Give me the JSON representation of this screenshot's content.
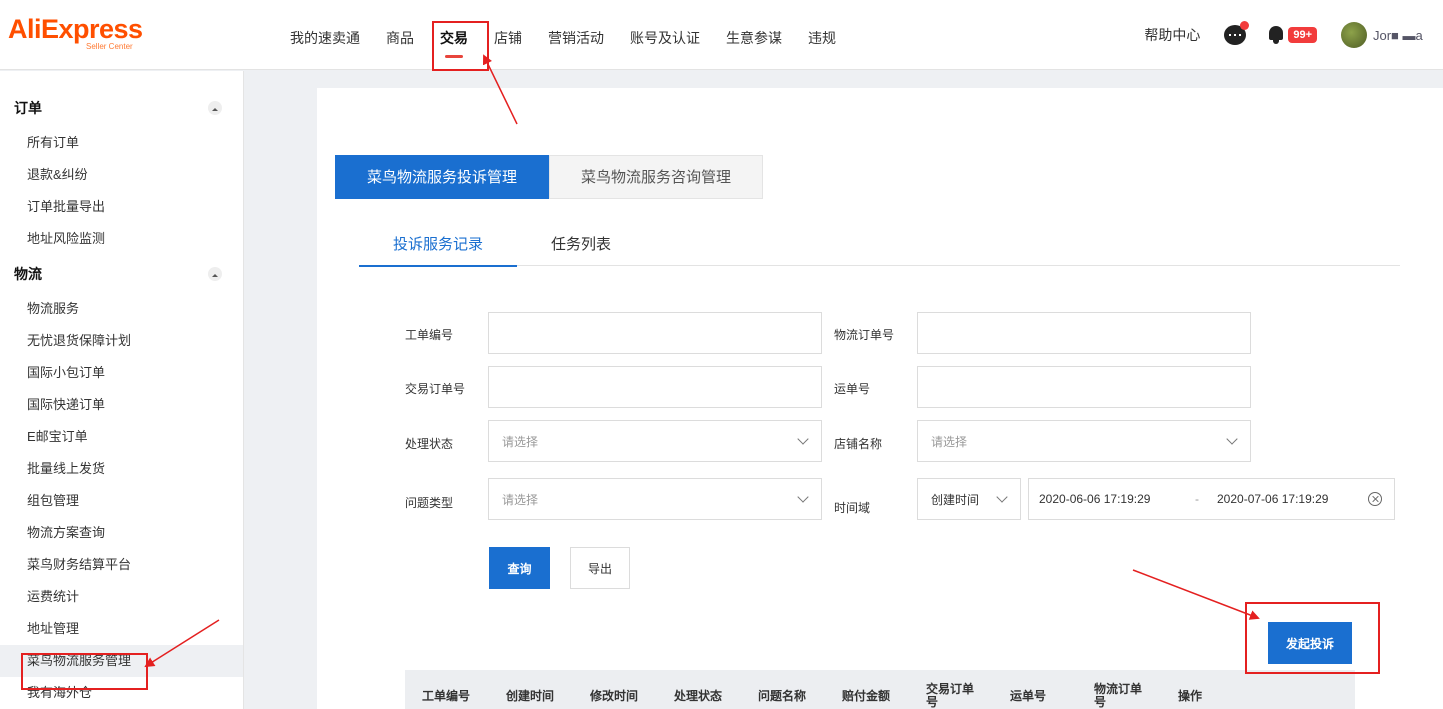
{
  "header": {
    "logo": "AliExpress",
    "logo_sub": "Seller Center",
    "nav": [
      "我的速卖通",
      "商品",
      "交易",
      "店铺",
      "营销活动",
      "账号及认证",
      "生意参谋",
      "违规"
    ],
    "help": "帮助中心",
    "notif_badge": "99+",
    "user_name": "Jor■ ▬a"
  },
  "sidebar": {
    "group_order": "订单",
    "order_items": [
      "所有订单",
      "退款&纠纷",
      "订单批量导出",
      "地址风险监测"
    ],
    "group_logistics": "物流",
    "logistics_items": [
      "物流服务",
      "无忧退货保障计划",
      "国际小包订单",
      "国际快递订单",
      "E邮宝订单",
      "批量线上发货",
      "组包管理",
      "物流方案查询",
      "菜鸟财务结算平台",
      "运费统计",
      "地址管理",
      "菜鸟物流服务管理",
      "我有海外仓"
    ]
  },
  "main": {
    "big_tabs": [
      "菜鸟物流服务投诉管理",
      "菜鸟物流服务咨询管理"
    ],
    "sub_tabs": [
      "投诉服务记录",
      "任务列表"
    ],
    "form": {
      "ticket_no": "工单编号",
      "logistics_order_no": "物流订单号",
      "trade_order_no": "交易订单号",
      "waybill_no": "运单号",
      "status": "处理状态",
      "store_name": "店铺名称",
      "issue_type": "问题类型",
      "time_range": "时间域",
      "select_placeholder": "请选择",
      "time_type": "创建时间",
      "date_start": "2020-06-06 17:19:29",
      "date_sep": "-",
      "date_end": "2020-07-06 17:19:29"
    },
    "search_btn": "查询",
    "export_btn": "导出",
    "complain_btn": "发起投诉",
    "table_headers": [
      "工单编号",
      "创建时间",
      "修改时间",
      "处理状态",
      "问题名称",
      "赔付金额",
      "交易订单号",
      "运单号",
      "物流订单号",
      "操作"
    ]
  },
  "colors": {
    "accent": "#1a6fd0",
    "annotation": "#e42020",
    "brand": "#ff4f00"
  }
}
